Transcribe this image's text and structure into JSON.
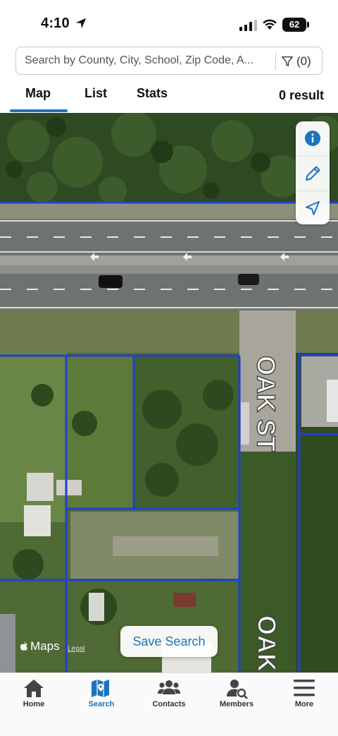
{
  "status_bar": {
    "time": "4:10",
    "battery": "62"
  },
  "search": {
    "placeholder": "Search by County, City, School, Zip Code, A...",
    "filter_count": "(0)"
  },
  "tabs": {
    "map": "Map",
    "list": "List",
    "stats": "Stats",
    "active": "Map"
  },
  "results": {
    "count_label": "0 result"
  },
  "map": {
    "street_label": "OAK ST",
    "street_label_partial": "OAK",
    "save_search_label": "Save Search",
    "maps_brand": "Maps",
    "legal_label": "Legal",
    "parcel_line_color": "#1f3fd9",
    "controls": [
      "info-icon",
      "pencil-icon",
      "location-arrow-icon"
    ]
  },
  "bottom_nav": {
    "items": [
      {
        "label": "Home",
        "icon": "home-icon",
        "active": false
      },
      {
        "label": "Search",
        "icon": "map-search-icon",
        "active": true
      },
      {
        "label": "Contacts",
        "icon": "contacts-icon",
        "active": false
      },
      {
        "label": "Members",
        "icon": "members-icon",
        "active": false
      },
      {
        "label": "More",
        "icon": "menu-icon",
        "active": false
      }
    ]
  },
  "colors": {
    "accent": "#1e73be"
  }
}
